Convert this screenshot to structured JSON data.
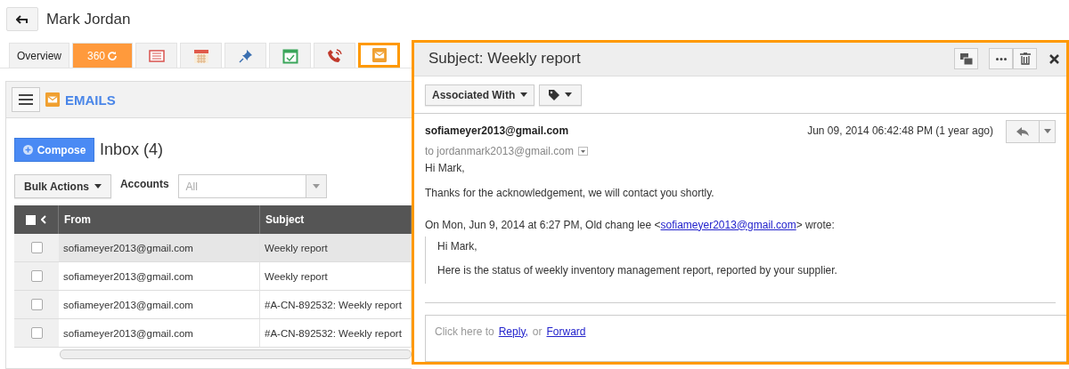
{
  "header": {
    "title": "Mark Jordan"
  },
  "tabs": [
    {
      "kind": "text",
      "label": "Overview",
      "selected": false
    },
    {
      "kind": "badge",
      "label": "360",
      "selected": false
    },
    {
      "kind": "icon",
      "selected": false
    },
    {
      "kind": "icon",
      "selected": false
    },
    {
      "kind": "icon",
      "selected": false
    },
    {
      "kind": "icon",
      "selected": false
    },
    {
      "kind": "icon",
      "selected": false
    },
    {
      "kind": "icon",
      "selected": true
    }
  ],
  "emails": {
    "title": "EMAILS",
    "compose": "Compose",
    "folder": "Inbox (4)",
    "bulk_actions": "Bulk Actions",
    "accounts_label": "Accounts",
    "accounts_value": "All",
    "select_all": {
      "checked": false
    },
    "columns": [
      "From",
      "Subject"
    ],
    "rows": [
      {
        "from": "sofiameyer2013@gmail.com",
        "subject": "Weekly report",
        "checked": false,
        "selected": true
      },
      {
        "from": "sofiameyer2013@gmail.com",
        "subject": "Weekly report",
        "checked": false,
        "selected": false
      },
      {
        "from": "sofiameyer2013@gmail.com",
        "subject": "#A-CN-892532: Weekly report",
        "checked": false,
        "selected": false
      },
      {
        "from": "sofiameyer2013@gmail.com",
        "subject": "#A-CN-892532: Weekly report",
        "checked": false,
        "selected": false
      }
    ]
  },
  "message": {
    "subject": "Subject: Weekly report",
    "associated_with": "Associated With",
    "sender": "sofiameyer2013@gmail.com",
    "date": "Jun 09, 2014 06:42:48 PM (1 year ago)",
    "to": "to jordanmark2013@gmail.com",
    "body": [
      "Hi Mark,",
      "Thanks for the acknowledgement, we will contact you shortly."
    ],
    "quote_intro_before": "On Mon, Jun 9, 2014 at 6:27 PM, Old chang lee <",
    "quote_link": "sofiameyer2013@gmail.com",
    "quote_intro_after": "> wrote:",
    "quoted": [
      "Hi Mark,",
      "Here is the status of weekly inventory management report, reported by your supplier."
    ],
    "reply_prompt": "Click here to",
    "reply_link": "Reply,",
    "or": "or",
    "forward_link": "Forward"
  }
}
